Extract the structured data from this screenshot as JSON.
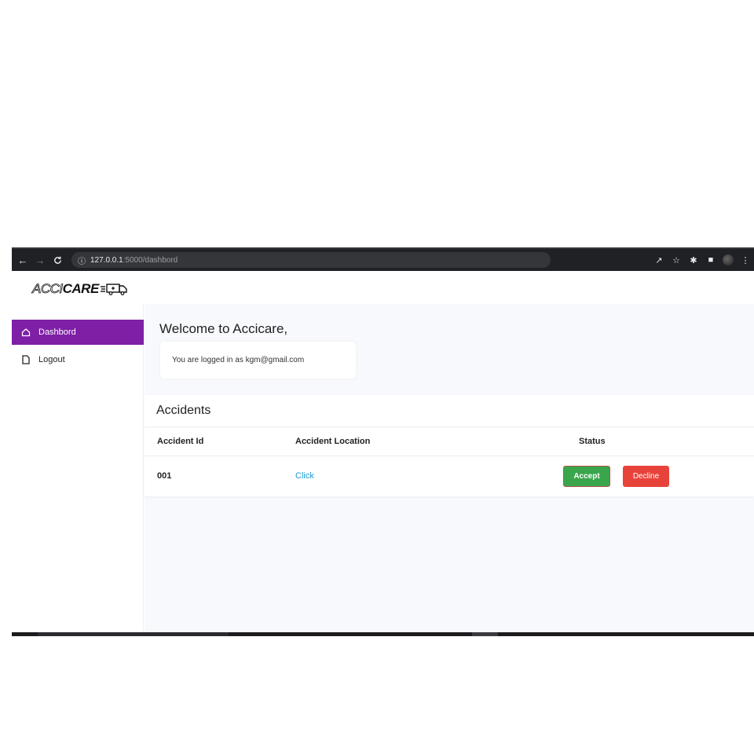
{
  "browser": {
    "url_host": "127.0.0.1",
    "url_path": ":5000/dashbord",
    "icons": [
      "back-icon",
      "forward-icon",
      "reload-icon",
      "info-icon",
      "share-icon",
      "star-icon",
      "extensions-icon",
      "sidepanel-icon",
      "profile-icon",
      "menu-icon"
    ]
  },
  "app": {
    "logo_outline": "ACCI",
    "logo_bold": "CARE"
  },
  "sidebar": {
    "items": [
      {
        "label": "Dashbord",
        "icon": "home-icon",
        "active": true
      },
      {
        "label": "Logout",
        "icon": "document-icon",
        "active": false
      }
    ]
  },
  "welcome": {
    "title": "Welcome to Accicare,",
    "login_text": "You are logged in as kgm@gmail.com"
  },
  "accidents": {
    "title": "Accidents",
    "columns": [
      "Accident Id",
      "Accident Location",
      "Status"
    ],
    "rows": [
      {
        "id": "001",
        "location_link": "Click",
        "accept_label": "Accept",
        "decline_label": "Decline"
      }
    ]
  },
  "colors": {
    "sidebar_active": "#7e1fa5",
    "accept": "#3aa64c",
    "decline": "#e8433a",
    "link": "#1a9ad6"
  }
}
